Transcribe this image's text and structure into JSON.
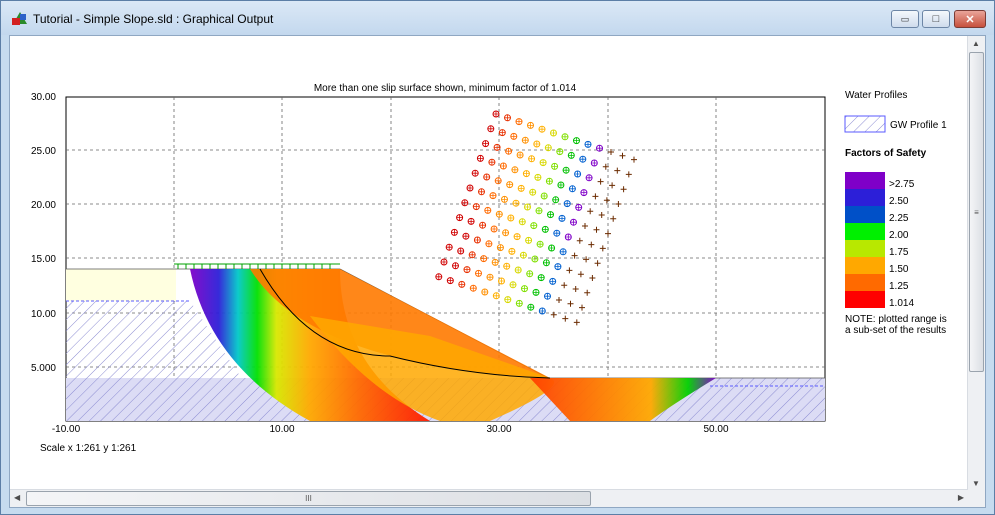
{
  "window": {
    "title": "Tutorial - Simple Slope.sld : Graphical Output",
    "minimize_symbol": "▭",
    "maximize_symbol": "□",
    "close_symbol": "✕",
    "icon": "slide-app-icon"
  },
  "plot": {
    "title": "More than one slip surface shown, minimum factor of 1.014",
    "y_ticks": [
      "30.00",
      "25.00",
      "20.00",
      "15.00",
      "10.00",
      "5.000"
    ],
    "x_ticks": [
      "-10.00",
      "10.00",
      "30.00",
      "50.00"
    ],
    "scale": "Scale x 1:261  y 1:261"
  },
  "legend": {
    "water_title": "Water Profiles",
    "water_item": "GW Profile 1",
    "fos_title": "Factors of Safety",
    "bands": [
      {
        "label": ">2.75",
        "color": "#7f00c8"
      },
      {
        "label": "2.50",
        "color": "#2c1fd8"
      },
      {
        "label": "2.25",
        "color": "#0050c8"
      },
      {
        "label": "2.00",
        "color": "#00f000"
      },
      {
        "label": "1.75",
        "color": "#b8e800"
      },
      {
        "label": "1.50",
        "color": "#ffa800"
      },
      {
        "label": "1.25",
        "color": "#ff6a00"
      },
      {
        "label": "1.014",
        "color": "#ff0000"
      }
    ],
    "note_line1": "NOTE: plotted range is",
    "note_line2": "a sub-set of the results"
  },
  "scrollbars": {
    "grip": "III",
    "v_grip": "≡",
    "arrow_up": "▲",
    "arrow_down": "▼",
    "arrow_left": "◀",
    "arrow_right": "▶"
  }
}
